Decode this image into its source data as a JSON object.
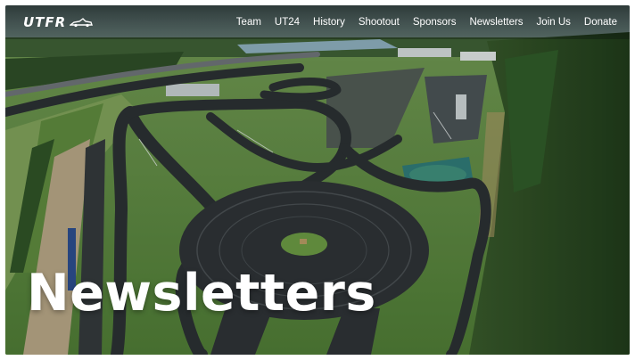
{
  "brand": {
    "logo_text": "UTFR",
    "logo_icon": "race-car-icon"
  },
  "nav": {
    "items": [
      {
        "label": "Team"
      },
      {
        "label": "UT24"
      },
      {
        "label": "History"
      },
      {
        "label": "Shootout"
      },
      {
        "label": "Sponsors"
      },
      {
        "label": "Newsletters"
      },
      {
        "label": "Join Us"
      },
      {
        "label": "Donate"
      }
    ]
  },
  "hero": {
    "title": "Newsletters",
    "image": "aerial-race-track-photo"
  },
  "colors": {
    "nav_text": "#ffffff",
    "title_text": "#ffffff",
    "grass": "#5e8b3f",
    "forest": "#2c4a24",
    "asphalt": "#2b2f33"
  }
}
